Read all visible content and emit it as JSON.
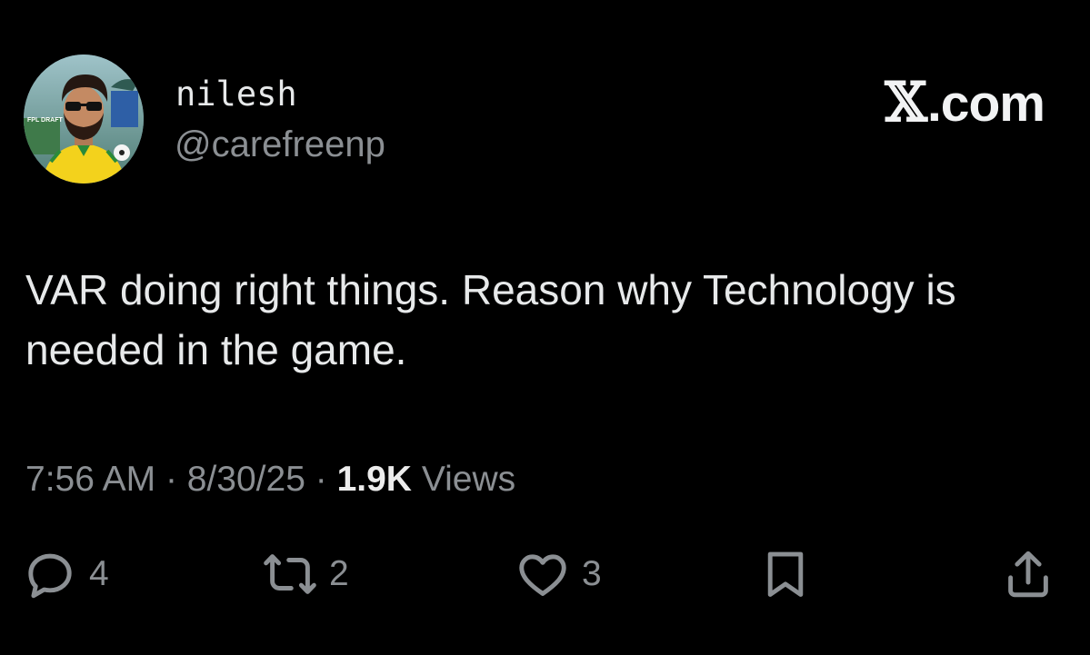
{
  "user": {
    "display_name": "nilesh",
    "handle": "@carefreenp",
    "avatar_badge": "FPL DRAFT"
  },
  "brand": {
    "x_glyph": "𝕏",
    "suffix": ".com"
  },
  "tweet": {
    "text": "VAR doing right things. Reason why Technology is needed in the game."
  },
  "meta": {
    "time": "7:56 AM",
    "separator": "·",
    "date": "8/30/25",
    "views_count": "1.9K",
    "views_label": "Views"
  },
  "actions": {
    "replies": "4",
    "reposts": "2",
    "likes": "3"
  },
  "icons": {
    "reply": "reply-icon",
    "repost": "repost-icon",
    "like": "heart-icon",
    "bookmark": "bookmark-icon",
    "share": "share-icon"
  },
  "colors": {
    "background": "#000000",
    "primary_text": "#e7e9ea",
    "secondary_text": "#8b8f93"
  }
}
